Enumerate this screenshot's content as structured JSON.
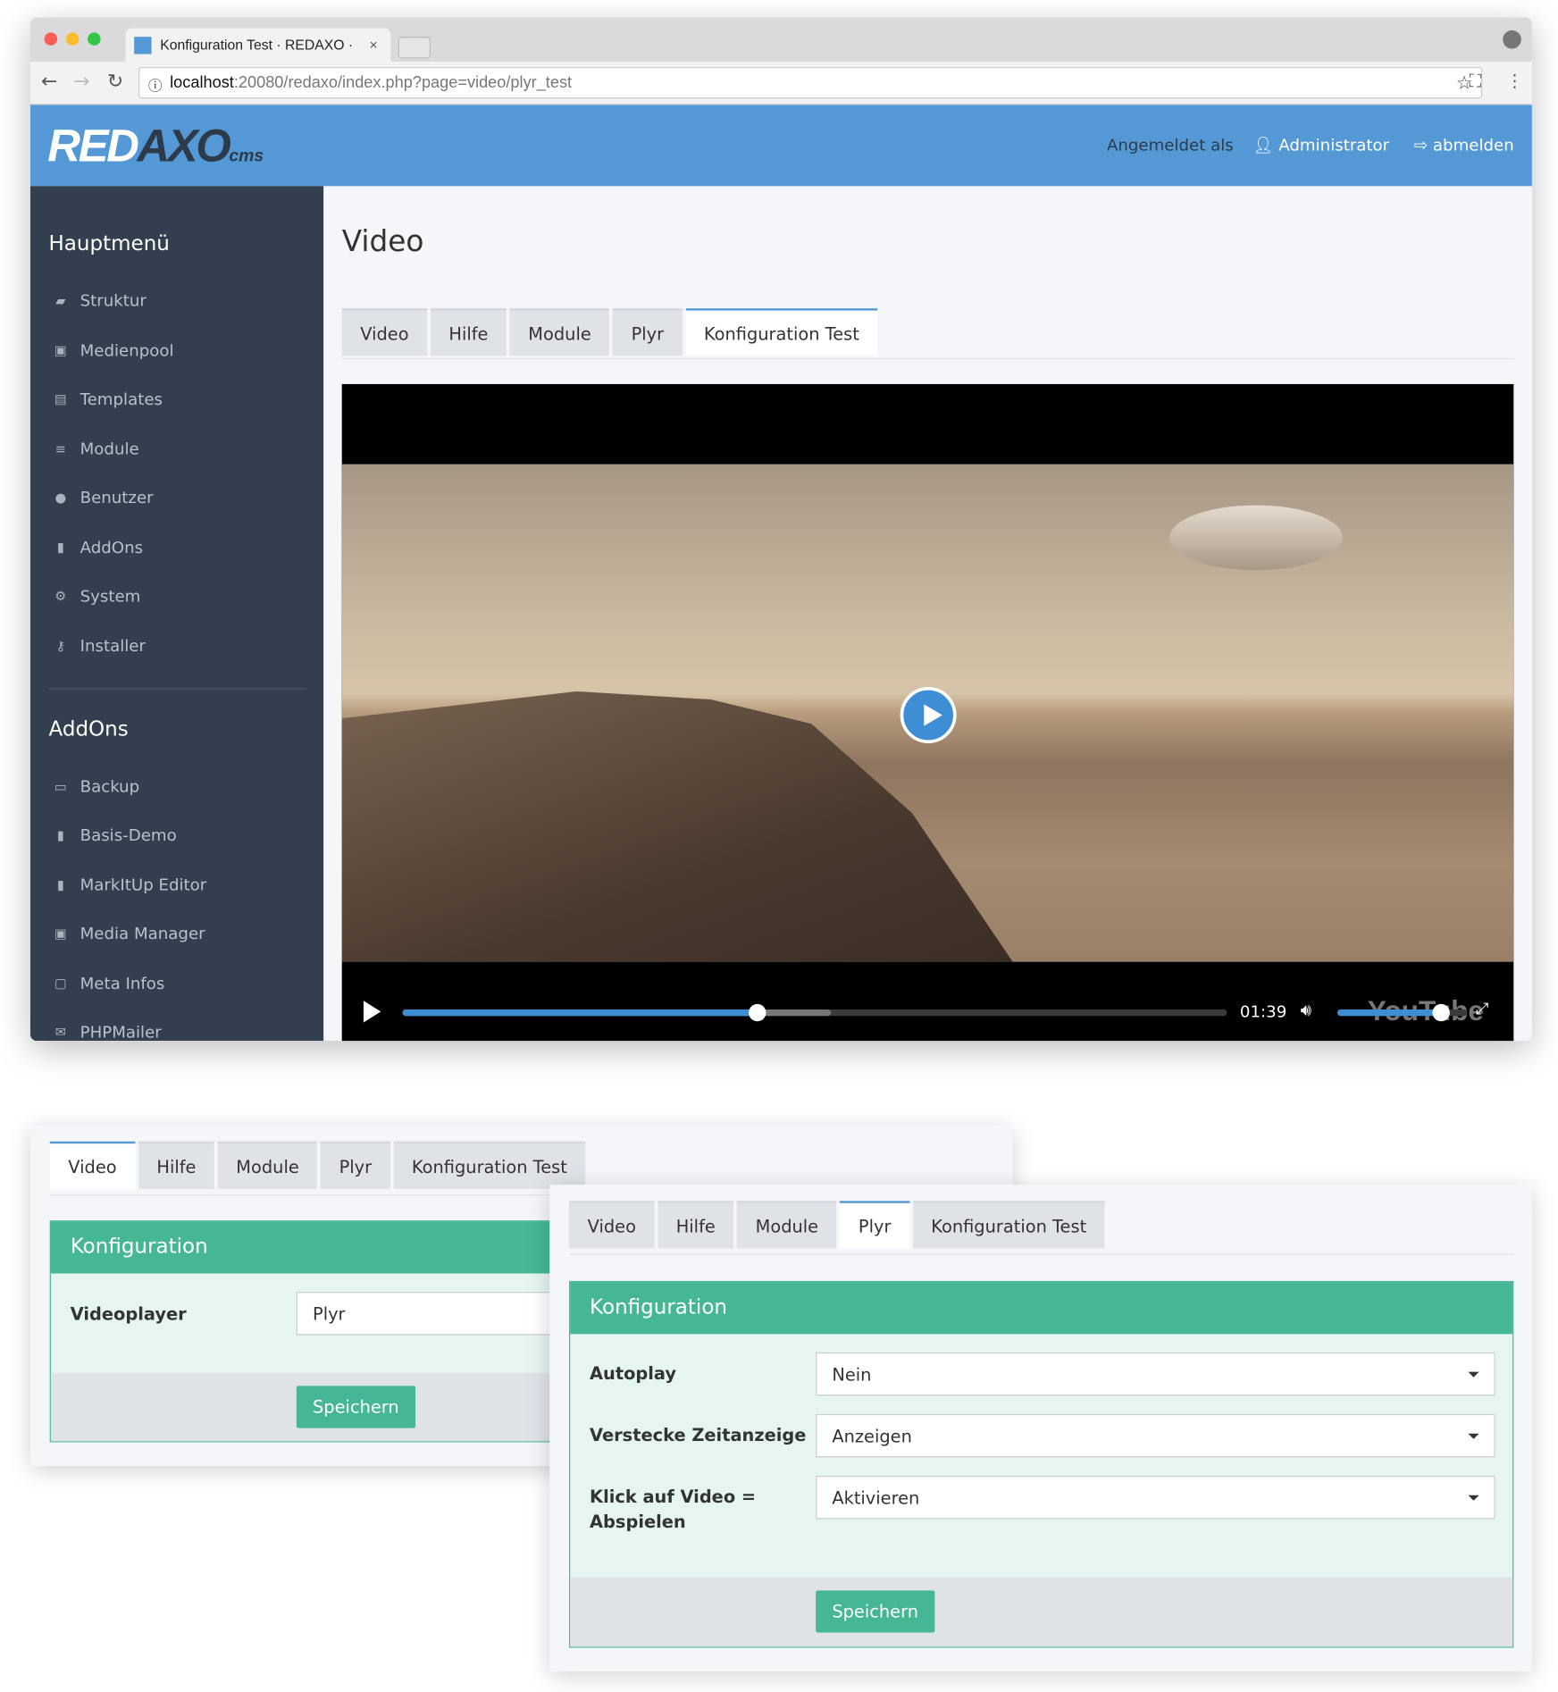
{
  "browser": {
    "tab_title": "Konfiguration Test · REDAXO ·",
    "url_host": "localhost",
    "url_rest": ":20080/redaxo/index.php?page=video/plyr_test"
  },
  "header": {
    "logo": "REDAXO",
    "logo_red": "RED",
    "logo_axo": "AXO",
    "logo_cms": "cms",
    "logged_in_as": "Angemeldet als",
    "user": "Administrator",
    "logout": "abmelden"
  },
  "sidebar": {
    "main_title": "Hauptmenü",
    "main_items": [
      {
        "label": "Struktur",
        "icon": "folder-open-icon"
      },
      {
        "label": "Medienpool",
        "icon": "image-icon"
      },
      {
        "label": "Templates",
        "icon": "newspaper-icon"
      },
      {
        "label": "Module",
        "icon": "database-icon"
      },
      {
        "label": "Benutzer",
        "icon": "user-icon"
      },
      {
        "label": "AddOns",
        "icon": "bookmark-icon"
      },
      {
        "label": "System",
        "icon": "cogs-icon"
      },
      {
        "label": "Installer",
        "icon": "key-icon"
      }
    ],
    "addons_title": "AddOns",
    "addon_items": [
      {
        "label": "Backup",
        "icon": "hdd-icon"
      },
      {
        "label": "Basis-Demo",
        "icon": "bookmark-icon"
      },
      {
        "label": "MarkItUp Editor",
        "icon": "bookmark-icon"
      },
      {
        "label": "Media Manager",
        "icon": "image-icon"
      },
      {
        "label": "Meta Infos",
        "icon": "tag-icon"
      },
      {
        "label": "PHPMailer",
        "icon": "envelope-icon"
      }
    ]
  },
  "main": {
    "title": "Video",
    "tabs": [
      "Video",
      "Hilfe",
      "Module",
      "Plyr",
      "Konfiguration Test"
    ],
    "active_tab": 4
  },
  "player": {
    "time": "01:39",
    "played_percent": 43,
    "buffered_percent": 52,
    "volume_percent": 80,
    "watermark": "YouTube"
  },
  "config_video": {
    "active_tab": 0,
    "heading": "Konfiguration",
    "label": "Videoplayer",
    "value": "Plyr",
    "save": "Speichern"
  },
  "config_plyr": {
    "active_tab": 3,
    "heading": "Konfiguration",
    "rows": [
      {
        "label": "Autoplay",
        "value": "Nein"
      },
      {
        "label": "Verstecke Zeitanzeige",
        "value": "Anzeigen"
      },
      {
        "label": "Klick auf Video = Abspielen",
        "value": "Aktivieren"
      }
    ],
    "save": "Speichern"
  },
  "colors": {
    "brand_blue": "#5499d5",
    "sidebar": "#323f4e",
    "accent_green": "#45b795"
  }
}
